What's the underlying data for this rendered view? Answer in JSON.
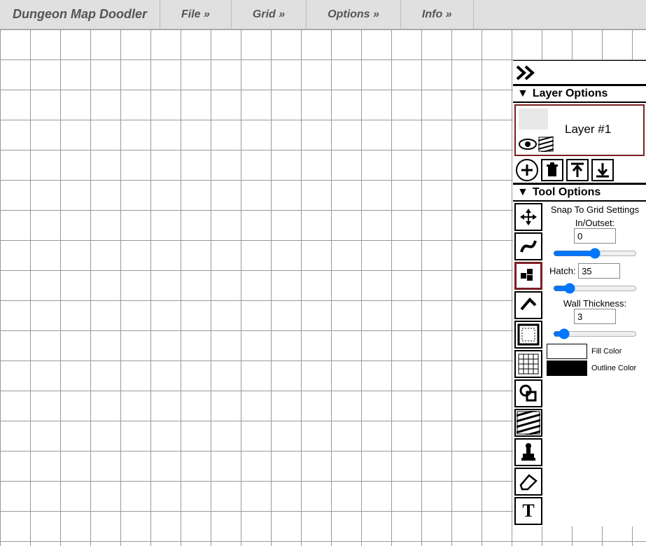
{
  "app_title": "Dungeon Map Doodler",
  "menus": {
    "file": "File »",
    "grid": "Grid »",
    "options": "Options »",
    "info": "Info »"
  },
  "layer_options": {
    "header": "Layer Options",
    "layers": [
      {
        "name": "Layer #1"
      }
    ]
  },
  "tool_options": {
    "header": "Tool Options",
    "snap_label": "Snap To Grid Settings",
    "inout_label": "In/Outset:",
    "inout_value": "0",
    "hatch_label": "Hatch:",
    "hatch_value": "35",
    "wall_label": "Wall Thickness:",
    "wall_value": "3",
    "fill_color_label": "Fill Color",
    "outline_color_label": "Outline Color"
  },
  "tools": [
    "move",
    "path",
    "tiles",
    "angle",
    "rect-pattern",
    "grid",
    "shapes",
    "hatch-fill",
    "stamp",
    "eraser",
    "text"
  ]
}
